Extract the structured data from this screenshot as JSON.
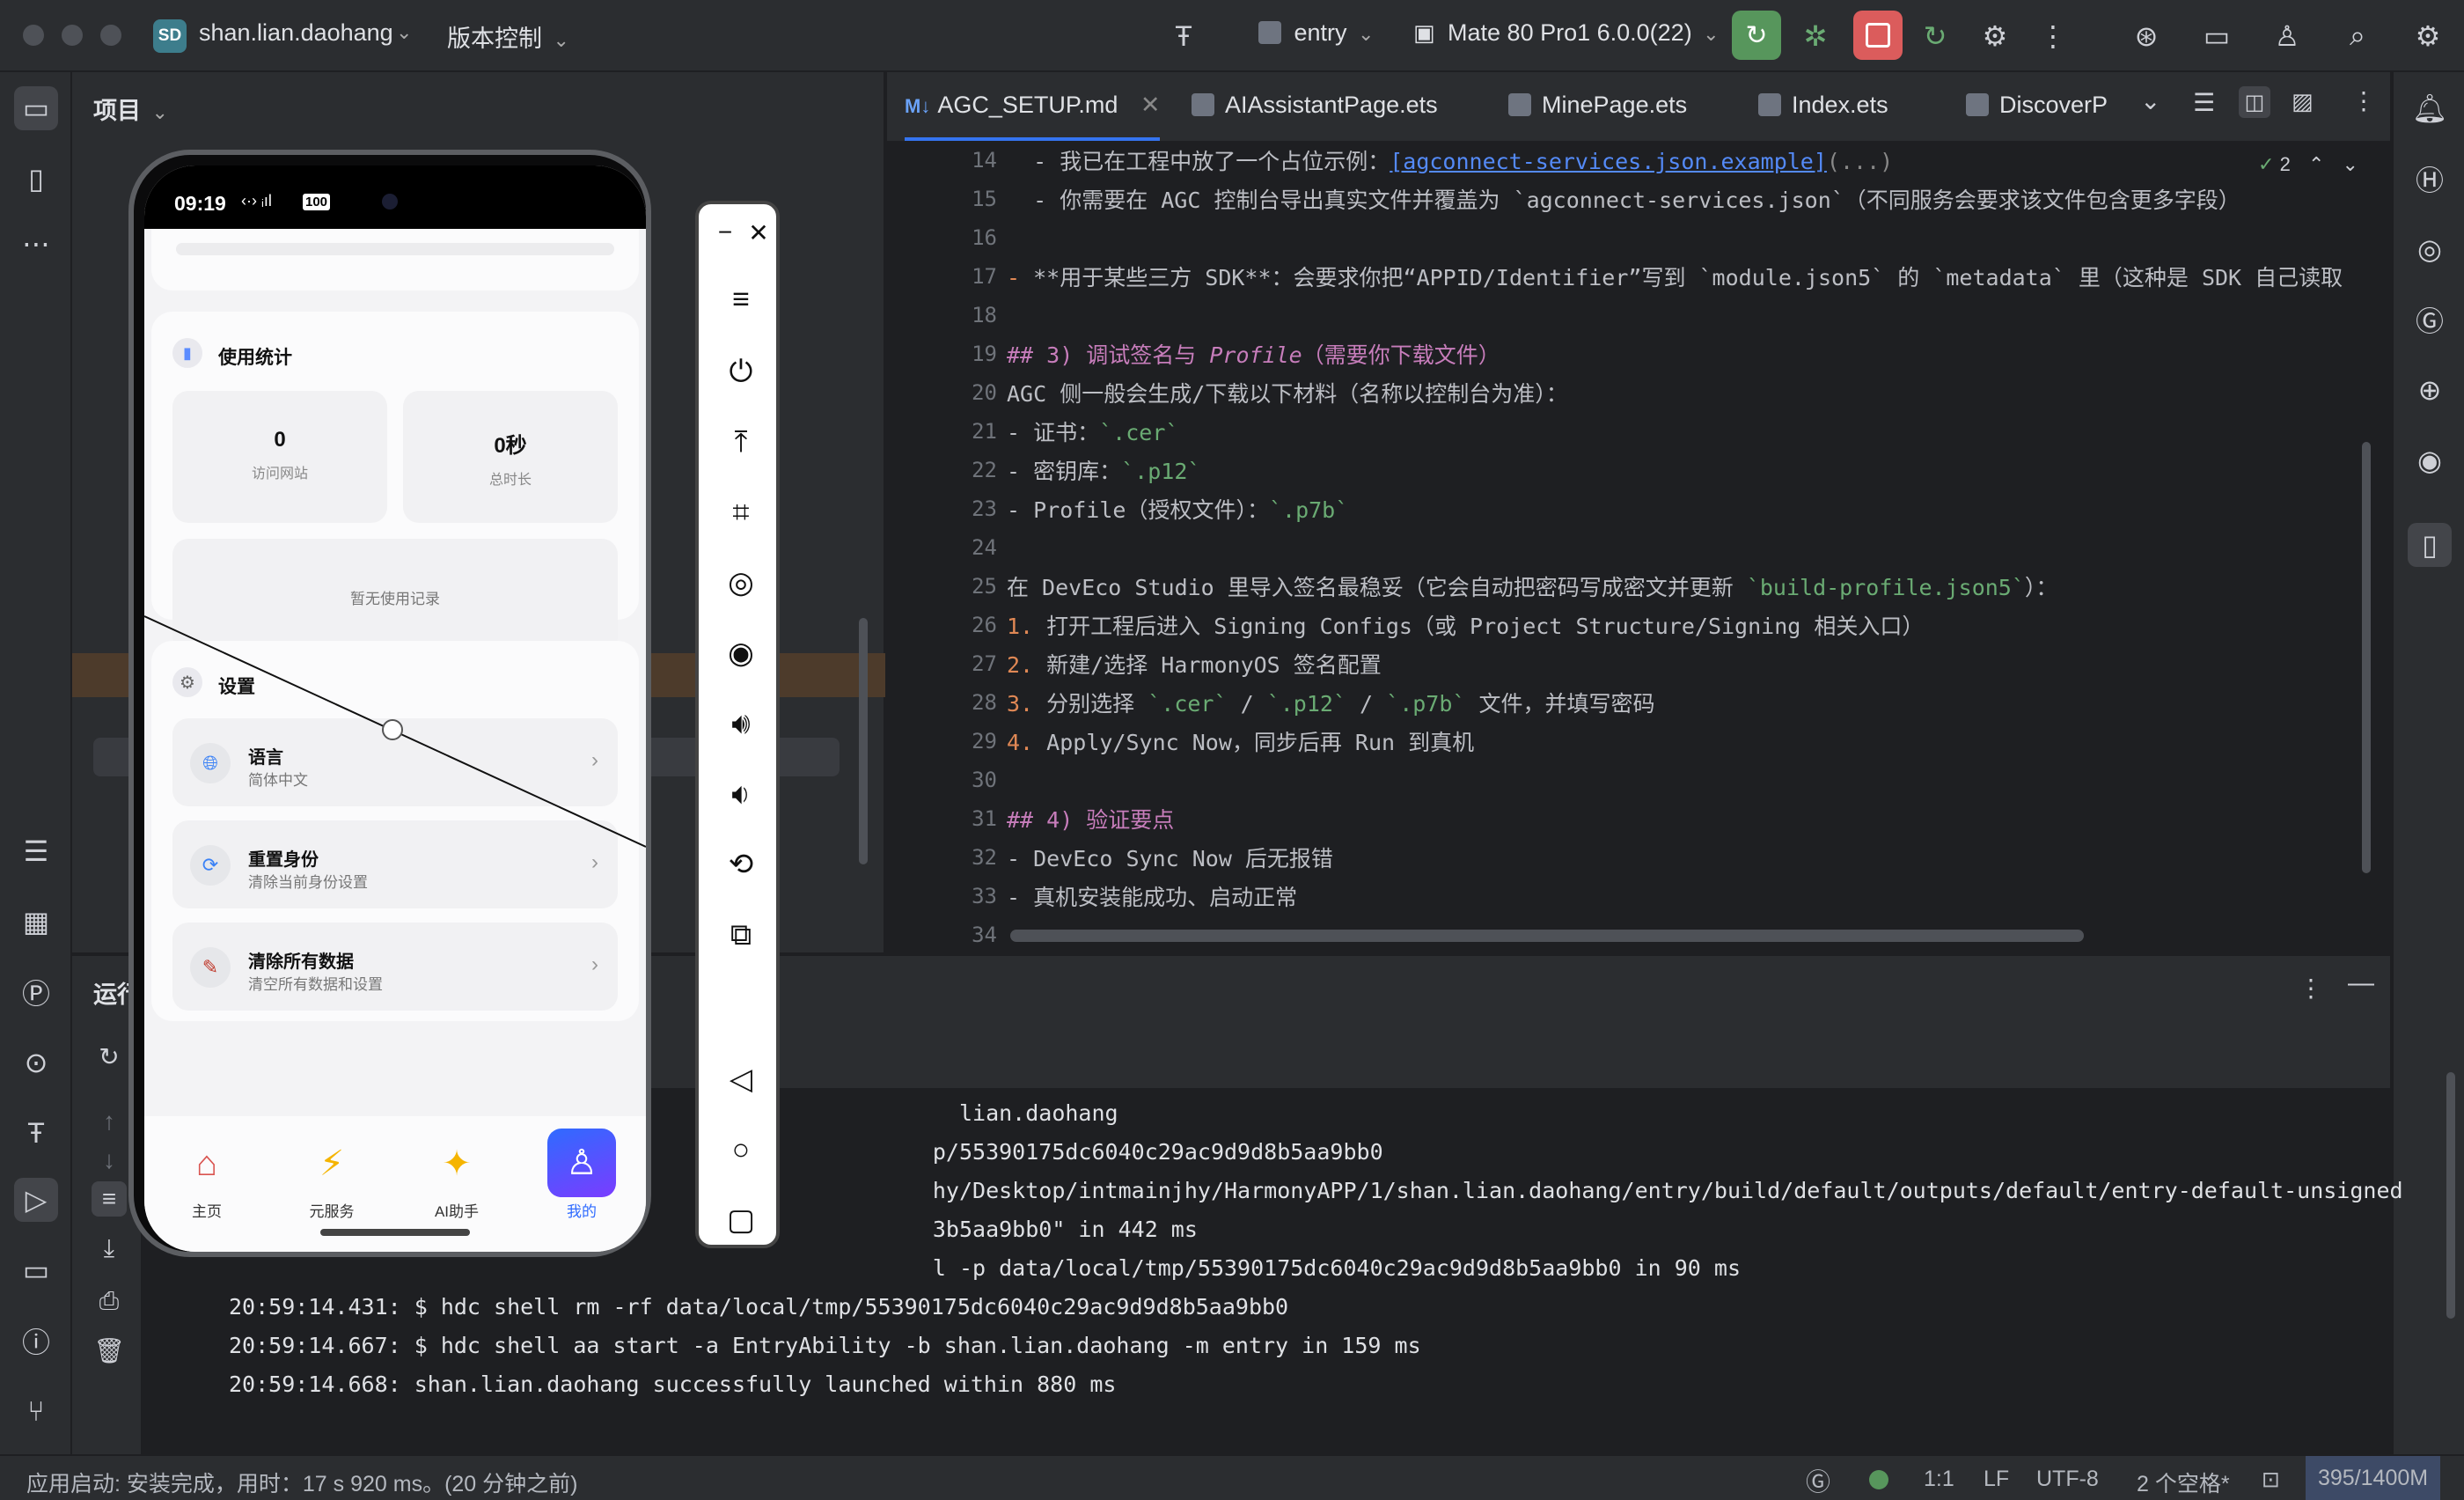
{
  "titlebar": {
    "project_badge": "SD",
    "project_name": "shan.lian.daohang",
    "vcs_label": "版本控制",
    "module_label": "entry",
    "device_label": "Mate 80 Pro1 6.0.0(22)"
  },
  "project_panel": {
    "title": "项目"
  },
  "tabs": [
    {
      "label": "AGC_SETUP.md",
      "prefix": "M↓",
      "active": true
    },
    {
      "label": "AIAssistantPage.ets"
    },
    {
      "label": "MinePage.ets"
    },
    {
      "label": "Index.ets"
    },
    {
      "label": "DiscoverP",
      "truncated": true
    }
  ],
  "editor": {
    "inspection_count": "2",
    "line_numbers": [
      "14",
      "15",
      "16",
      "17",
      "18",
      "19",
      "20",
      "21",
      "22",
      "23",
      "24",
      "25",
      "26",
      "27",
      "28",
      "29",
      "30",
      "31",
      "32",
      "33",
      "34"
    ],
    "lines": {
      "l14_pre": "  - 我已在工程中放了一个占位示例：",
      "l14_link": "[agconnect-services.json.example]",
      "l14_post": "(...)",
      "l15": "  - 你需要在 AGC 控制台导出真实文件并覆盖为 `agconnect-services.json`（不同服务会要求该文件包含更多字段）",
      "l17_pre": "- ",
      "l17_bold": "**用于某些三方 SDK**",
      "l17_post": "：会要求你把“APPID/Identifier”写到 `module.json5` 的 `metadata` 里（这种是 SDK 自己读取",
      "l19_pre": "## 3) 调试签名与 ",
      "l19_italic": "Profile",
      "l19_post": "（需要你下载文件）",
      "l20": "AGC 侧一般会生成/下载以下材料（名称以控制台为准）：",
      "l21_pre": "- 证书：",
      "l21_code": "`.cer`",
      "l22_pre": "- 密钥库：",
      "l22_code": "`.p12`",
      "l23_pre": "- Profile（授权文件）：",
      "l23_code": "`.p7b`",
      "l25_pre": "在 DevEco Studio 里导入签名最稳妥（它会自动把密码写成密文并更新 ",
      "l25_code": "`build-profile.json5`",
      "l25_post": "）：",
      "l26_num": "1.",
      "l26": " 打开工程后进入 Signing Configs（或 Project Structure/Signing 相关入口）",
      "l27_num": "2.",
      "l27": " 新建/选择 HarmonyOS 签名配置",
      "l28_num": "3.",
      "l28_a": " 分别选择 ",
      "l28_c1": "`.cer`",
      "l28_b": " / ",
      "l28_c2": "`.p12`",
      "l28_c3": "`.p7b`",
      "l28_d": " 文件，并填写密码",
      "l29_num": "4.",
      "l29": " Apply/Sync Now，同步后再 Run 到真机",
      "l31": "## 4) 验证要点",
      "l32": "- DevEco Sync Now 后无报错",
      "l33": "- 真机安装能成功、启动正常"
    }
  },
  "run_panel": {
    "title": "运行",
    "console_lines": [
      "top                lian.daohang",
      "/lo              p/55390175dc6040c29ac9d9d8b5aa9bb0",
      "/in              hy/Desktop/intmainjhy/HarmonyAPP/1/shan.lian.daohang/entry/build/default/outputs/default/entry-default-unsigned",
      "c29              3b5aa9bb0\" in 442 ms",
      "                 l -p data/local/tmp/55390175dc6040c29ac9d9d8b5aa9bb0 in 90 ms",
      "20:59:14.431: $ hdc shell rm -rf data/local/tmp/55390175dc6040c29ac9d9d8b5aa9bb0",
      "20:59:14.667: $ hdc shell aa start -a EntryAbility -b shan.lian.daohang -m entry in 159 ms",
      "20:59:14.668: shan.lian.daohang successfully launched within 880 ms"
    ]
  },
  "statusbar": {
    "message": "应用启动: 安装完成，用时：17 s 920 ms。(20 分钟之前)",
    "position": "1:1",
    "line_sep": "LF",
    "encoding": "UTF-8",
    "indent": "2 个空格*",
    "memory": "395/1400M"
  },
  "phone": {
    "time": "09:19",
    "battery": "100",
    "usage_title": "使用统计",
    "kpi_visits_value": "0",
    "kpi_visits_label": "访问网站",
    "kpi_duration_value": "0秒",
    "kpi_duration_label": "总时长",
    "empty_text": "暂无使用记录",
    "settings_title": "设置",
    "rows": [
      {
        "title": "语言",
        "subtitle": "简体中文",
        "icon": "globe-icon"
      },
      {
        "title": "重置身份",
        "subtitle": "清除当前身份设置",
        "icon": "refresh-icon"
      },
      {
        "title": "清除所有数据",
        "subtitle": "清空所有数据和设置",
        "icon": "broom-icon"
      }
    ],
    "nav": [
      {
        "label": "主页"
      },
      {
        "label": "元服务"
      },
      {
        "label": "AI助手"
      },
      {
        "label": "我的",
        "active": true
      }
    ]
  },
  "colors": {
    "accent": "#3574f0",
    "run_green": "#57965c",
    "stop_red": "#db5c5c",
    "nav_active": "#2f6bff"
  }
}
